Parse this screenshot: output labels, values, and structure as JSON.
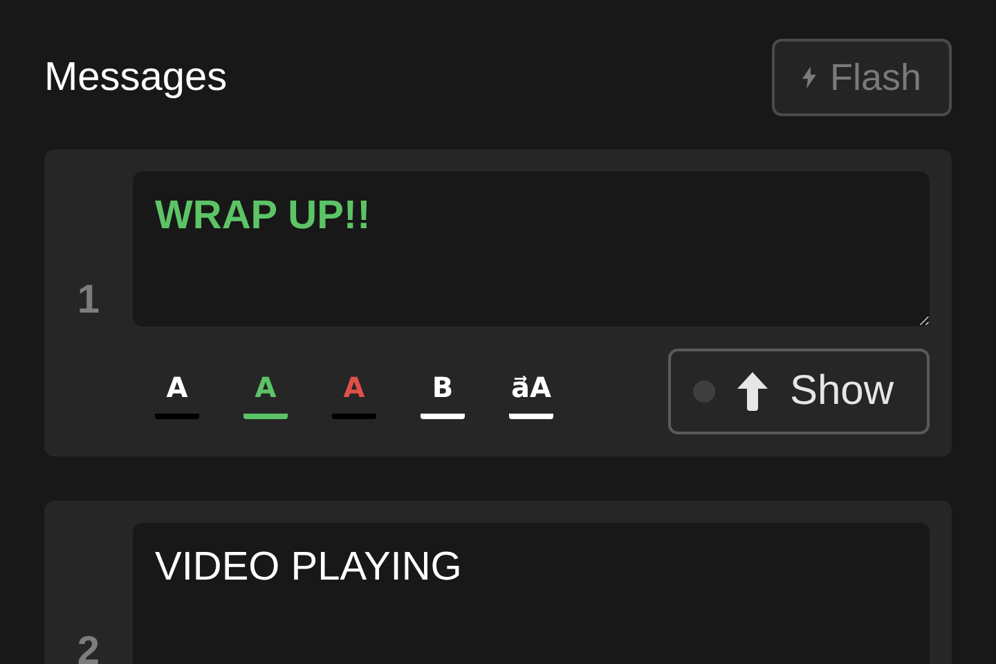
{
  "header": {
    "title": "Messages",
    "flash_button": {
      "label": "Flash",
      "disabled": true
    }
  },
  "messages": [
    {
      "number": "1",
      "text": "WRAP UP!!",
      "color": "#5cc466",
      "bold": true,
      "formats": [
        {
          "kind": "color",
          "label": "A",
          "color": "#ffffff",
          "selected": false
        },
        {
          "kind": "color",
          "label": "A",
          "color": "#5cc466",
          "selected": true
        },
        {
          "kind": "color",
          "label": "A",
          "color": "#e0504a",
          "selected": false
        },
        {
          "kind": "bold",
          "label": "B",
          "selected": true
        },
        {
          "kind": "case",
          "label": "a⃗A",
          "selected": true
        }
      ],
      "show_button": {
        "label": "Show",
        "live": false
      }
    },
    {
      "number": "2",
      "text": "VIDEO PLAYING",
      "color": "#ffffff",
      "bold": false
    }
  ]
}
